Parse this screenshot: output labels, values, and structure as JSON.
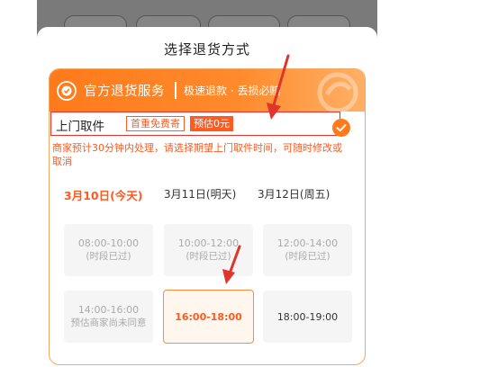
{
  "sheet": {
    "title": "选择退货方式"
  },
  "header": {
    "title": "官方退货服务",
    "slogan": "极速退款 · 丢损必赔"
  },
  "option": {
    "label": "上门取件",
    "badge_free": "首重免费寄",
    "badge_estimate": "预估0元",
    "selected": true
  },
  "note": "商家预计30分钟内处理，请选择期望上门取件时间，可随时修改或取消",
  "dates": [
    {
      "label": "3月10日(今天)",
      "active": true
    },
    {
      "label": "3月11日(明天)",
      "active": false
    },
    {
      "label": "3月12日(周五)",
      "active": false
    }
  ],
  "slots": [
    {
      "time": "08:00-10:00",
      "sub": "(时段已过)",
      "state": "disabled"
    },
    {
      "time": "10:00-12:00",
      "sub": "(时段已过)",
      "state": "disabled"
    },
    {
      "time": "12:00-14:00",
      "sub": "(时段已过)",
      "state": "disabled"
    },
    {
      "time": "14:00-16:00",
      "sub": "预估商家尚未同意",
      "state": "disabled"
    },
    {
      "time": "16:00-18:00",
      "sub": "",
      "state": "selected"
    },
    {
      "time": "18:00-19:00",
      "sub": "",
      "state": "available"
    }
  ],
  "colors": {
    "accent": "#ff7a1a",
    "highlight_border": "#e0342c",
    "annotation_arrow": "#e0342c"
  }
}
